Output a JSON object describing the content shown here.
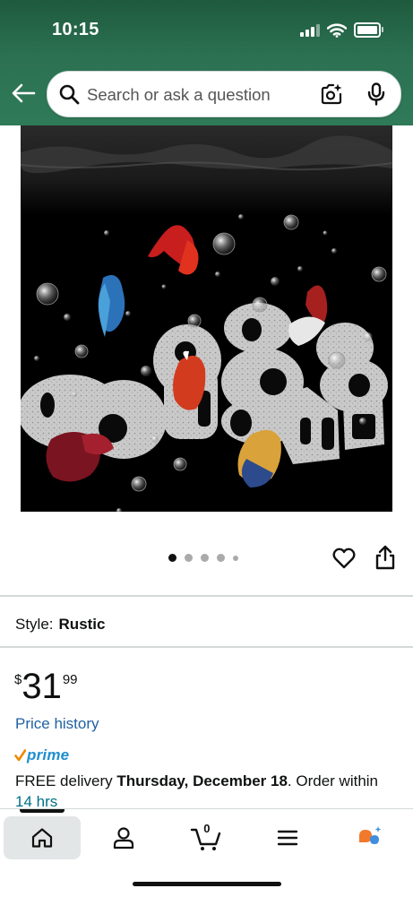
{
  "status_bar": {
    "time": "10:15",
    "icons": [
      "signal-icon",
      "wifi-icon",
      "battery-icon"
    ]
  },
  "header": {
    "back_icon": "arrow-left-icon",
    "search": {
      "placeholder": "Search or ask a question",
      "camera_icon": "camera-search-icon",
      "mic_icon": "microphone-icon"
    }
  },
  "product_image": {
    "alt": "Betta fish swimming among rustic stone aquarium caves with bubbles"
  },
  "carousel": {
    "total_images": 5,
    "active_index": 0,
    "actions": [
      "heart-icon",
      "share-icon"
    ]
  },
  "style": {
    "label": "Style:",
    "value": "Rustic"
  },
  "price": {
    "symbol": "$",
    "whole": "31",
    "fraction": "99",
    "history_link": "Price history"
  },
  "prime": {
    "label": "prime"
  },
  "delivery": {
    "prefix": "FREE delivery ",
    "date": "Thursday, December 18",
    "suffix": ". Order within",
    "countdown": "14 hrs"
  },
  "tabbar": {
    "items": [
      {
        "name": "home",
        "icon": "home-icon",
        "active": true
      },
      {
        "name": "account",
        "icon": "person-icon",
        "active": false
      },
      {
        "name": "cart",
        "icon": "cart-icon",
        "active": false,
        "count": "0"
      },
      {
        "name": "menu",
        "icon": "hamburger-menu-icon",
        "active": false
      },
      {
        "name": "rufus",
        "icon": "rufus-assistant-icon",
        "active": false
      }
    ]
  },
  "colors": {
    "header_green": "#2b7152",
    "link_blue": "#2162a1",
    "prime_blue": "#1f8ecf",
    "prime_check_orange": "#f08804",
    "countdown_teal": "#007185"
  }
}
